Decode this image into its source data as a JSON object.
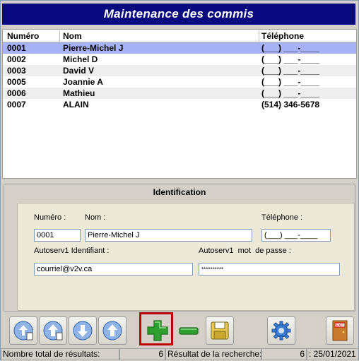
{
  "window": {
    "title": "Maintenance des commis"
  },
  "grid": {
    "columns": [
      "Numéro",
      "Nom",
      "Téléphone"
    ],
    "rows": [
      {
        "num": "0001",
        "nom": "Pierre-Michel J",
        "tel": "(___) ___-____"
      },
      {
        "num": "0002",
        "nom": "Michel D",
        "tel": "(___) ___-____"
      },
      {
        "num": "0003",
        "nom": "David V",
        "tel": "(___) ___-____"
      },
      {
        "num": "0005",
        "nom": "Joannie A",
        "tel": "(___) ___-____"
      },
      {
        "num": "0006",
        "nom": "Mathieu",
        "tel": "(___) ___-____"
      },
      {
        "num": "0007",
        "nom": "ALAIN",
        "tel": "(514) 346-5678"
      }
    ]
  },
  "identification": {
    "title": "Identification",
    "numero_label": "Numéro :",
    "numero_value": "0001",
    "nom_label": "Nom :",
    "nom_value": "Pierre-Michel J",
    "telephone_label": "Téléphone :",
    "telephone_value": "(___) ___-____",
    "identifiant_label": "Autoserv1 Identifiant :",
    "identifiant_value": "courriel@v2v.ca",
    "motdepasse_label": "Autoserv1  mot  de passe :",
    "motdepasse_value": "**********"
  },
  "toolbar": {
    "buttons": [
      "first-record-icon",
      "previous-record-icon",
      "next-record-icon",
      "last-record-icon",
      "add-icon",
      "remove-icon",
      "save-icon",
      "settings-icon",
      "exit-icon"
    ],
    "exit_label": "EXIT"
  },
  "statusbar": {
    "total_label": "Nombre total de résultats:",
    "total_value": "6",
    "search_label": "Résultat de la recherche:",
    "search_value": "6",
    "date": ": 25/01/2021"
  },
  "colors": {
    "title_bg": "#0a0a80",
    "selected_row": "#a7b2f7",
    "add_green": "#2fa02f",
    "highlight": "#c00000"
  }
}
